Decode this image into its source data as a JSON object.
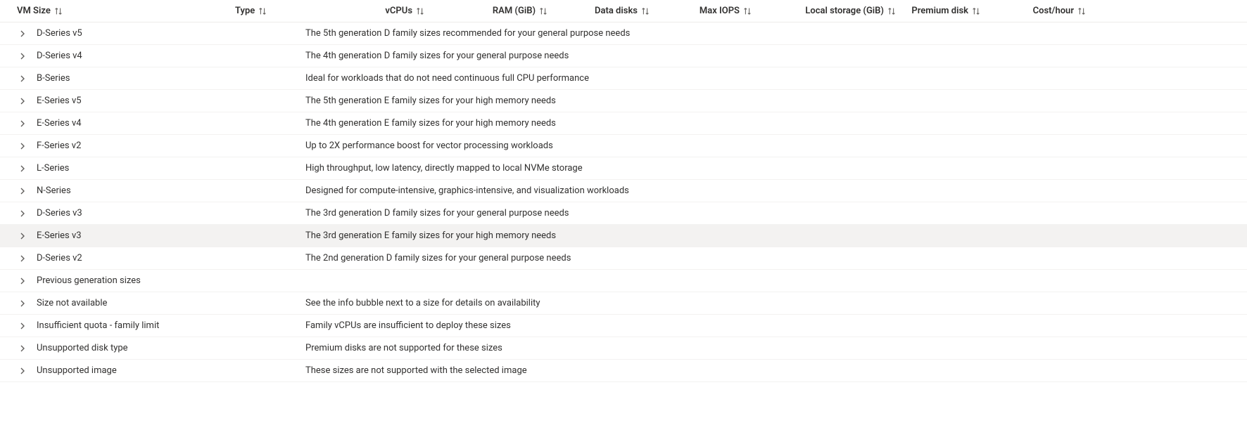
{
  "columns": {
    "vmsize": "VM Size",
    "type": "Type",
    "vcpus": "vCPUs",
    "ram": "RAM (GiB)",
    "disks": "Data disks",
    "iops": "Max IOPS",
    "local": "Local storage (GiB)",
    "premium": "Premium disk",
    "cost": "Cost/hour"
  },
  "rows": [
    {
      "name": "D-Series v5",
      "desc": "The 5th generation D family sizes recommended for your general purpose needs",
      "hovered": false
    },
    {
      "name": "D-Series v4",
      "desc": "The 4th generation D family sizes for your general purpose needs",
      "hovered": false
    },
    {
      "name": "B-Series",
      "desc": "Ideal for workloads that do not need continuous full CPU performance",
      "hovered": false
    },
    {
      "name": "E-Series v5",
      "desc": "The 5th generation E family sizes for your high memory needs",
      "hovered": false
    },
    {
      "name": "E-Series v4",
      "desc": "The 4th generation E family sizes for your high memory needs",
      "hovered": false
    },
    {
      "name": "F-Series v2",
      "desc": "Up to 2X performance boost for vector processing workloads",
      "hovered": false
    },
    {
      "name": "L-Series",
      "desc": "High throughput, low latency, directly mapped to local NVMe storage",
      "hovered": false
    },
    {
      "name": "N-Series",
      "desc": "Designed for compute-intensive, graphics-intensive, and visualization workloads",
      "hovered": false
    },
    {
      "name": "D-Series v3",
      "desc": "The 3rd generation D family sizes for your general purpose needs",
      "hovered": false
    },
    {
      "name": "E-Series v3",
      "desc": "The 3rd generation E family sizes for your high memory needs",
      "hovered": true
    },
    {
      "name": "D-Series v2",
      "desc": "The 2nd generation D family sizes for your general purpose needs",
      "hovered": false
    },
    {
      "name": "Previous generation sizes",
      "desc": "",
      "hovered": false
    },
    {
      "name": "Size not available",
      "desc": "See the info bubble next to a size for details on availability",
      "hovered": false
    },
    {
      "name": "Insufficient quota - family limit",
      "desc": "Family vCPUs are insufficient to deploy these sizes",
      "hovered": false
    },
    {
      "name": "Unsupported disk type",
      "desc": "Premium disks are not supported for these sizes",
      "hovered": false
    },
    {
      "name": "Unsupported image",
      "desc": "These sizes are not supported with the selected image",
      "hovered": false
    }
  ]
}
